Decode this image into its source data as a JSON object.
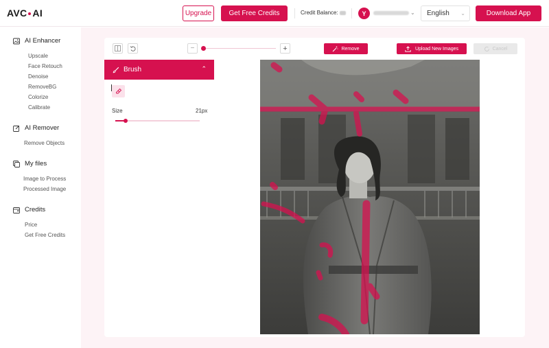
{
  "header": {
    "logo_left": "AVC",
    "logo_right": "AI",
    "upgrade_label": "Upgrade",
    "free_credits_label": "Get Free Credits",
    "credit_balance_label": "Credit Balance:",
    "avatar_initial": "Y",
    "language": "English",
    "download_label": "Download App"
  },
  "sidebar": {
    "groups": [
      {
        "title": "AI Enhancer",
        "icon": "image-icon",
        "items": [
          "Upscale",
          "Face Retouch",
          "Denoise",
          "RemoveBG",
          "Colorize",
          "Calibrate"
        ]
      },
      {
        "title": "AI Remover",
        "icon": "edit-icon",
        "items": [
          "Remove Objects"
        ]
      },
      {
        "title": "My files",
        "icon": "folder-icon",
        "items": [
          "Image to Process",
          "Processed Image"
        ]
      },
      {
        "title": "Credits",
        "icon": "wallet-icon",
        "items": [
          "Price",
          "Get Free Credits"
        ]
      }
    ]
  },
  "toolbar": {
    "remove_label": "Remove",
    "upload_label": "Upload New Images",
    "cancel_label": "Cancel",
    "zoom_level": 0
  },
  "brush": {
    "title": "Brush",
    "size_label": "Size",
    "size_value": "21px",
    "size_fraction": 0.12
  },
  "colors": {
    "accent": "#d6114f",
    "accent_light": "#fbe1ea",
    "page_bg": "#fdf3f6"
  }
}
